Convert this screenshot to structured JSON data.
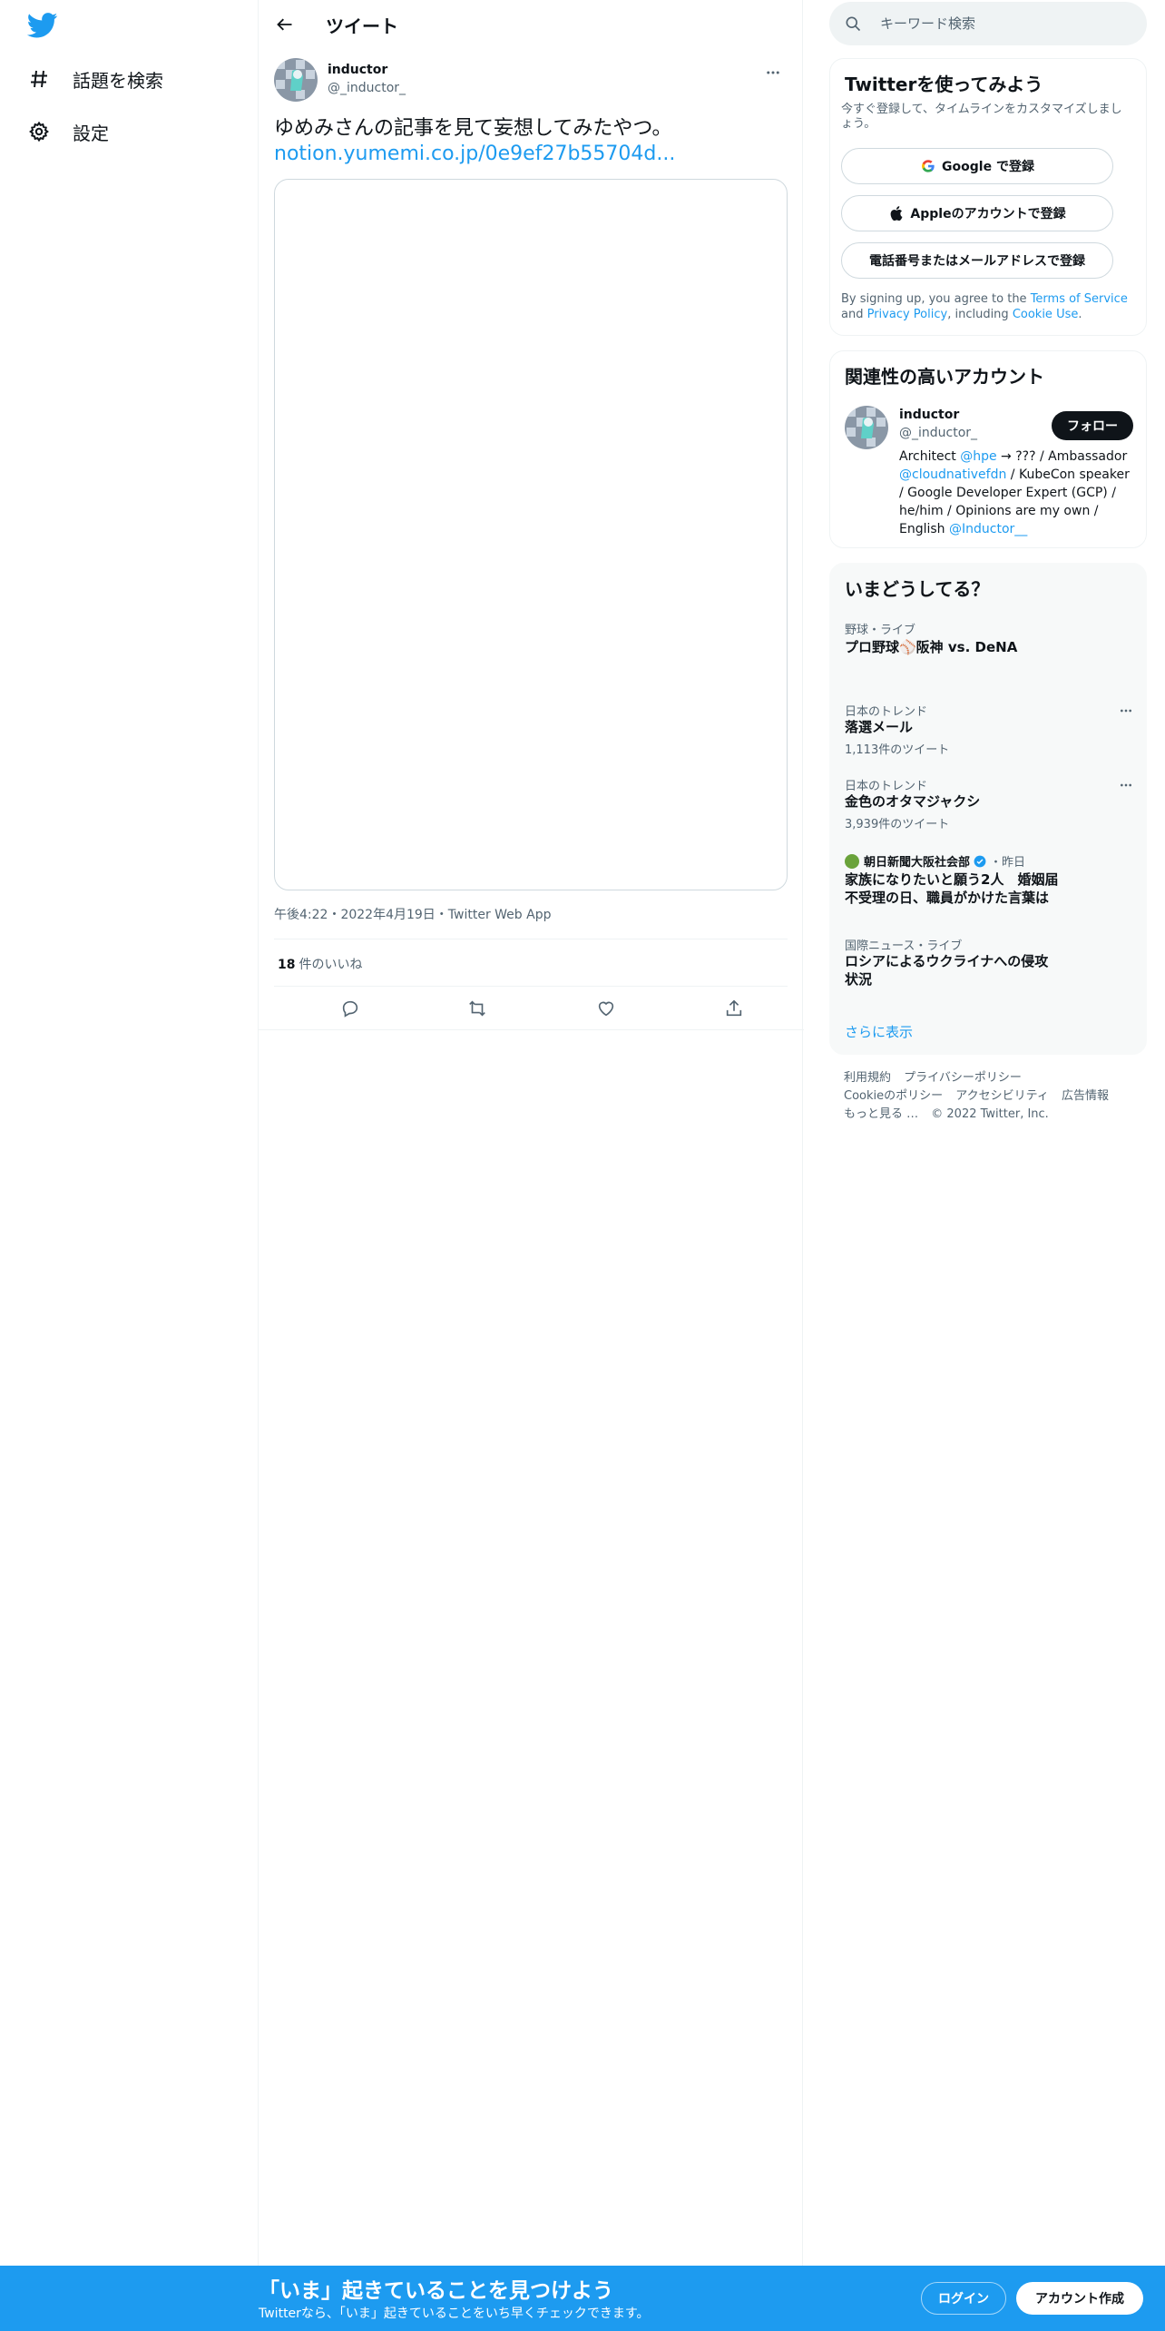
{
  "sidebar": {
    "logo": "twitter-bird-icon",
    "items": [
      {
        "icon": "hashtag-icon",
        "label": "話題を検索"
      },
      {
        "icon": "gear-icon",
        "label": "設定"
      }
    ]
  },
  "header": {
    "title": "ツイート"
  },
  "tweet": {
    "author_name": "inductor",
    "author_handle": "@_inductor_",
    "text": "ゆめみさんの記事を見て妄想してみたやつ。",
    "link": "notion.yumemi.co.jp/0e9ef27b55704d...",
    "meta": "午後4:22・2022年4月19日・Twitter Web App",
    "likes_count": "18",
    "likes_label": "件のいいね"
  },
  "search": {
    "placeholder": "キーワード検索"
  },
  "signup_card": {
    "title": "Twitterを使ってみよう",
    "subtitle": "今すぐ登録して、タイムラインをカスタマイズしましょう。",
    "google_button": "Google で登録",
    "apple_button": "Appleのアカウントで登録",
    "phone_button": "電話番号またはメールアドレスで登録",
    "terms_prefix": "By signing up, you agree to the ",
    "terms_link": "Terms of Service",
    "terms_and": " and ",
    "privacy_link": "Privacy Policy",
    "terms_including": ", including ",
    "cookie_link": "Cookie Use",
    "terms_end": "."
  },
  "related": {
    "title": "関連性の高いアカウント",
    "name": "inductor",
    "handle": "@_inductor_",
    "follow_button": "フォロー",
    "bio_1": "Architect ",
    "bio_mention_1": "@hpe",
    "bio_2": " → ??? / Ambassador ",
    "bio_mention_2": "@cloudnativefdn",
    "bio_3": " / KubeCon speaker / Google Developer Expert (GCP) / he/him / Opinions are my own / English ",
    "bio_mention_3": "@Inductor__"
  },
  "trends": {
    "title": "いまどうしてる？",
    "items": [
      {
        "context": "野球・ライブ",
        "title": "プロ野球⚾阪神 vs. DeNA"
      },
      {
        "context": "日本のトレンド",
        "title": "落選メール",
        "count": "1,113件のツイート"
      },
      {
        "context": "日本のトレンド",
        "title": "金色のオタマジャクシ",
        "count": "3,939件のツイート"
      },
      {
        "source": "朝日新聞大阪社会部",
        "time": "・昨日",
        "title_line1": "家族になりたいと願う2人　婚姻届",
        "title_line2": "不受理の日、職員がかけた言葉は"
      },
      {
        "context": "国際ニュース・ライブ",
        "title_line1": "ロシアによるウクライナへの侵攻",
        "title_line2": "状況"
      }
    ],
    "show_more": "さらに表示"
  },
  "footer": {
    "links_row1": [
      "利用規約",
      "プライバシーポリシー"
    ],
    "links_row2": [
      "Cookieのポリシー",
      "アクセシビリティ",
      "広告情報"
    ],
    "more": "もっと見る …",
    "copyright": "© 2022 Twitter, Inc."
  },
  "bottom_bar": {
    "title": "「いま」起きていることを見つけよう",
    "subtitle": "Twitterなら、「いま」起きていることをいち早くチェックできます。",
    "login_button": "ログイン",
    "signup_button": "アカウント作成"
  },
  "colors": {
    "brand": "#1d9bf0",
    "text": "#0f1419",
    "secondary": "#536471",
    "border": "#eff3f4"
  }
}
